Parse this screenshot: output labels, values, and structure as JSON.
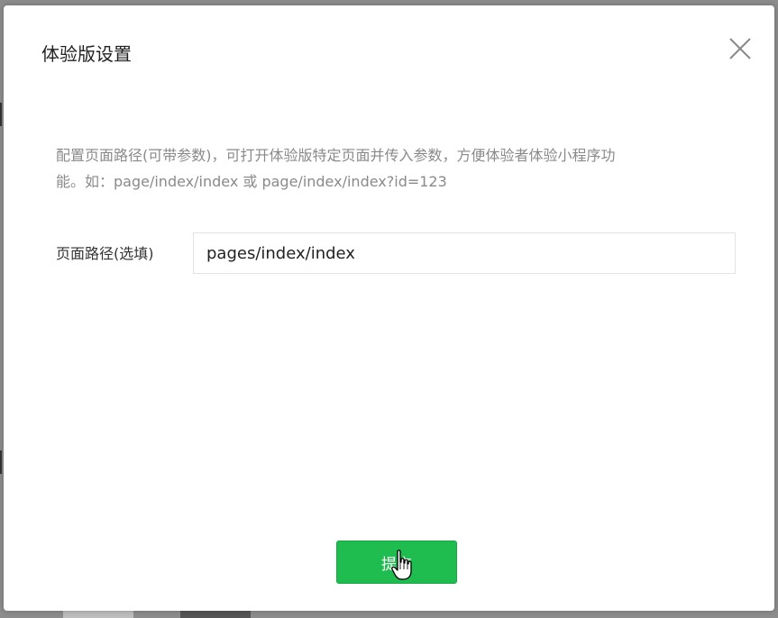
{
  "dialog": {
    "title": "体验版设置",
    "close_icon": "close-icon",
    "description_line1": "配置页面路径(可带参数)，可打开体验版特定页面并传入参数，方便体验者体验小程序功",
    "description_line2": "能。如：page/index/index 或 page/index/index?id=123",
    "path_label": "页面路径(选填)",
    "path_value": "pages/index/index",
    "submit_label": "提交"
  },
  "colors": {
    "accent": "#1fbc4f",
    "overlay": "#8c8c8c"
  },
  "cursor_icon": "hand-pointer-icon"
}
